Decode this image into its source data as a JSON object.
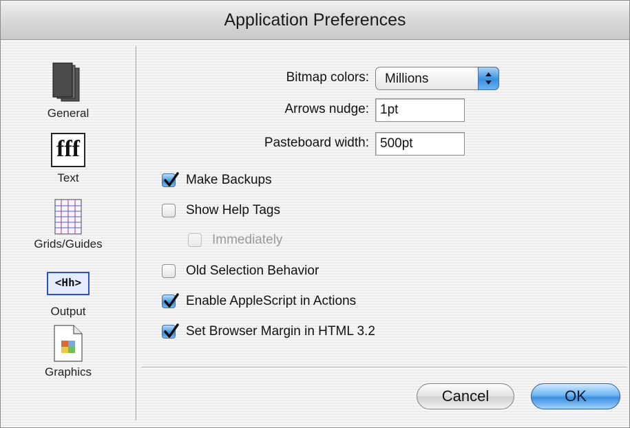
{
  "window": {
    "title": "Application Preferences"
  },
  "sidebar": {
    "items": [
      {
        "label": "General",
        "icon": "general-icon"
      },
      {
        "label": "Text",
        "icon": "text-icon",
        "glyph": "fff"
      },
      {
        "label": "Grids/Guides",
        "icon": "grids-guides-icon"
      },
      {
        "label": "Output",
        "icon": "output-icon",
        "glyph": "<Hh>"
      },
      {
        "label": "Graphics",
        "icon": "graphics-icon"
      }
    ]
  },
  "form": {
    "bitmap_colors": {
      "label": "Bitmap colors:",
      "value": "Millions"
    },
    "arrows_nudge": {
      "label": "Arrows nudge:",
      "value": "1pt"
    },
    "pasteboard_width": {
      "label": "Pasteboard width:",
      "value": "500pt"
    }
  },
  "checkboxes": [
    {
      "label": "Make Backups",
      "checked": true,
      "enabled": true
    },
    {
      "label": "Show Help Tags",
      "checked": false,
      "enabled": true
    },
    {
      "label": "Immediately",
      "checked": false,
      "enabled": false
    },
    {
      "label": "Old Selection Behavior",
      "checked": false,
      "enabled": true
    },
    {
      "label": "Enable AppleScript in Actions",
      "checked": true,
      "enabled": true
    },
    {
      "label": "Set Browser Margin in HTML 3.2",
      "checked": true,
      "enabled": true
    }
  ],
  "buttons": {
    "cancel": "Cancel",
    "ok": "OK"
  },
  "colors": {
    "accent": "#3c8fe0",
    "window_bg": "#ececec"
  }
}
